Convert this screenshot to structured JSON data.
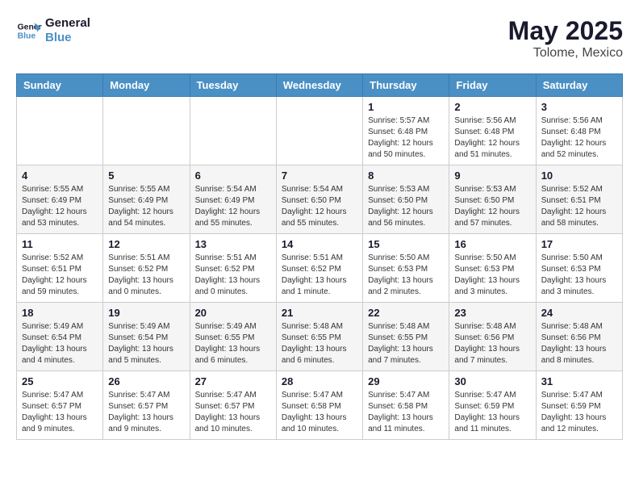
{
  "header": {
    "logo_line1": "General",
    "logo_line2": "Blue",
    "month": "May 2025",
    "location": "Tolome, Mexico"
  },
  "days_of_week": [
    "Sunday",
    "Monday",
    "Tuesday",
    "Wednesday",
    "Thursday",
    "Friday",
    "Saturday"
  ],
  "weeks": [
    [
      {
        "day": "",
        "info": ""
      },
      {
        "day": "",
        "info": ""
      },
      {
        "day": "",
        "info": ""
      },
      {
        "day": "",
        "info": ""
      },
      {
        "day": "1",
        "info": "Sunrise: 5:57 AM\nSunset: 6:48 PM\nDaylight: 12 hours\nand 50 minutes."
      },
      {
        "day": "2",
        "info": "Sunrise: 5:56 AM\nSunset: 6:48 PM\nDaylight: 12 hours\nand 51 minutes."
      },
      {
        "day": "3",
        "info": "Sunrise: 5:56 AM\nSunset: 6:48 PM\nDaylight: 12 hours\nand 52 minutes."
      }
    ],
    [
      {
        "day": "4",
        "info": "Sunrise: 5:55 AM\nSunset: 6:49 PM\nDaylight: 12 hours\nand 53 minutes."
      },
      {
        "day": "5",
        "info": "Sunrise: 5:55 AM\nSunset: 6:49 PM\nDaylight: 12 hours\nand 54 minutes."
      },
      {
        "day": "6",
        "info": "Sunrise: 5:54 AM\nSunset: 6:49 PM\nDaylight: 12 hours\nand 55 minutes."
      },
      {
        "day": "7",
        "info": "Sunrise: 5:54 AM\nSunset: 6:50 PM\nDaylight: 12 hours\nand 55 minutes."
      },
      {
        "day": "8",
        "info": "Sunrise: 5:53 AM\nSunset: 6:50 PM\nDaylight: 12 hours\nand 56 minutes."
      },
      {
        "day": "9",
        "info": "Sunrise: 5:53 AM\nSunset: 6:50 PM\nDaylight: 12 hours\nand 57 minutes."
      },
      {
        "day": "10",
        "info": "Sunrise: 5:52 AM\nSunset: 6:51 PM\nDaylight: 12 hours\nand 58 minutes."
      }
    ],
    [
      {
        "day": "11",
        "info": "Sunrise: 5:52 AM\nSunset: 6:51 PM\nDaylight: 12 hours\nand 59 minutes."
      },
      {
        "day": "12",
        "info": "Sunrise: 5:51 AM\nSunset: 6:52 PM\nDaylight: 13 hours\nand 0 minutes."
      },
      {
        "day": "13",
        "info": "Sunrise: 5:51 AM\nSunset: 6:52 PM\nDaylight: 13 hours\nand 0 minutes."
      },
      {
        "day": "14",
        "info": "Sunrise: 5:51 AM\nSunset: 6:52 PM\nDaylight: 13 hours\nand 1 minute."
      },
      {
        "day": "15",
        "info": "Sunrise: 5:50 AM\nSunset: 6:53 PM\nDaylight: 13 hours\nand 2 minutes."
      },
      {
        "day": "16",
        "info": "Sunrise: 5:50 AM\nSunset: 6:53 PM\nDaylight: 13 hours\nand 3 minutes."
      },
      {
        "day": "17",
        "info": "Sunrise: 5:50 AM\nSunset: 6:53 PM\nDaylight: 13 hours\nand 3 minutes."
      }
    ],
    [
      {
        "day": "18",
        "info": "Sunrise: 5:49 AM\nSunset: 6:54 PM\nDaylight: 13 hours\nand 4 minutes."
      },
      {
        "day": "19",
        "info": "Sunrise: 5:49 AM\nSunset: 6:54 PM\nDaylight: 13 hours\nand 5 minutes."
      },
      {
        "day": "20",
        "info": "Sunrise: 5:49 AM\nSunset: 6:55 PM\nDaylight: 13 hours\nand 6 minutes."
      },
      {
        "day": "21",
        "info": "Sunrise: 5:48 AM\nSunset: 6:55 PM\nDaylight: 13 hours\nand 6 minutes."
      },
      {
        "day": "22",
        "info": "Sunrise: 5:48 AM\nSunset: 6:55 PM\nDaylight: 13 hours\nand 7 minutes."
      },
      {
        "day": "23",
        "info": "Sunrise: 5:48 AM\nSunset: 6:56 PM\nDaylight: 13 hours\nand 7 minutes."
      },
      {
        "day": "24",
        "info": "Sunrise: 5:48 AM\nSunset: 6:56 PM\nDaylight: 13 hours\nand 8 minutes."
      }
    ],
    [
      {
        "day": "25",
        "info": "Sunrise: 5:47 AM\nSunset: 6:57 PM\nDaylight: 13 hours\nand 9 minutes."
      },
      {
        "day": "26",
        "info": "Sunrise: 5:47 AM\nSunset: 6:57 PM\nDaylight: 13 hours\nand 9 minutes."
      },
      {
        "day": "27",
        "info": "Sunrise: 5:47 AM\nSunset: 6:57 PM\nDaylight: 13 hours\nand 10 minutes."
      },
      {
        "day": "28",
        "info": "Sunrise: 5:47 AM\nSunset: 6:58 PM\nDaylight: 13 hours\nand 10 minutes."
      },
      {
        "day": "29",
        "info": "Sunrise: 5:47 AM\nSunset: 6:58 PM\nDaylight: 13 hours\nand 11 minutes."
      },
      {
        "day": "30",
        "info": "Sunrise: 5:47 AM\nSunset: 6:59 PM\nDaylight: 13 hours\nand 11 minutes."
      },
      {
        "day": "31",
        "info": "Sunrise: 5:47 AM\nSunset: 6:59 PM\nDaylight: 13 hours\nand 12 minutes."
      }
    ]
  ]
}
